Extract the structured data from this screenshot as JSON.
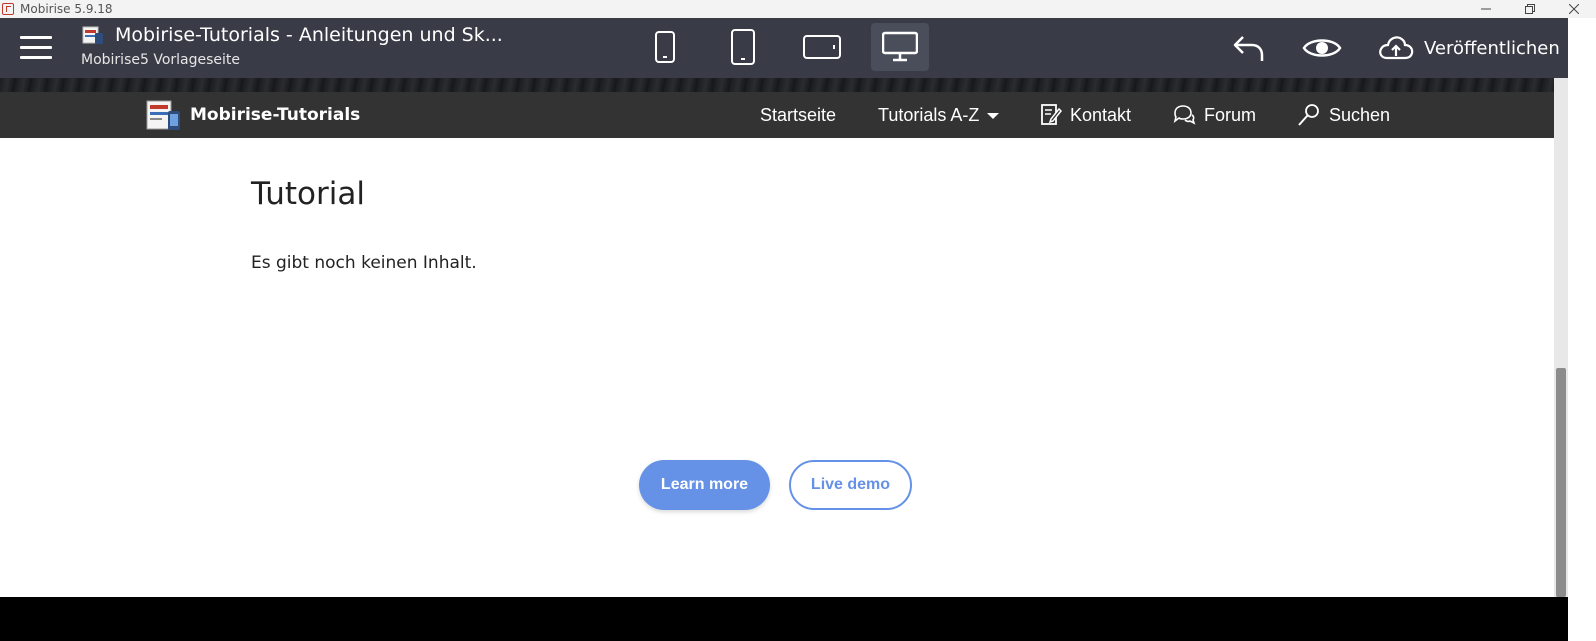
{
  "window": {
    "title": "Mobirise 5.9.18"
  },
  "toolbar": {
    "project_title": "Mobirise-Tutorials - Anleitungen und Sk...",
    "project_subtitle": "Mobirise5 Vorlageseite",
    "devices": [
      {
        "name": "phone-portrait",
        "active": false
      },
      {
        "name": "tablet-portrait",
        "active": false
      },
      {
        "name": "tablet-landscape",
        "active": false
      },
      {
        "name": "desktop",
        "active": true
      }
    ],
    "publish_label": "Veröffentlichen"
  },
  "site": {
    "brand": "Mobirise-Tutorials",
    "nav": {
      "startseite": "Startseite",
      "tutorials": "Tutorials A-Z",
      "kontakt": "Kontakt",
      "forum": "Forum",
      "suchen": "Suchen"
    }
  },
  "content": {
    "heading": "Tutorial",
    "text": "Es gibt noch keinen Inhalt.",
    "primary_button": "Learn more",
    "secondary_button": "Live demo"
  },
  "colors": {
    "toolbar_bg": "#393c47",
    "nav_bg": "#333333",
    "accent": "#6592e6"
  }
}
